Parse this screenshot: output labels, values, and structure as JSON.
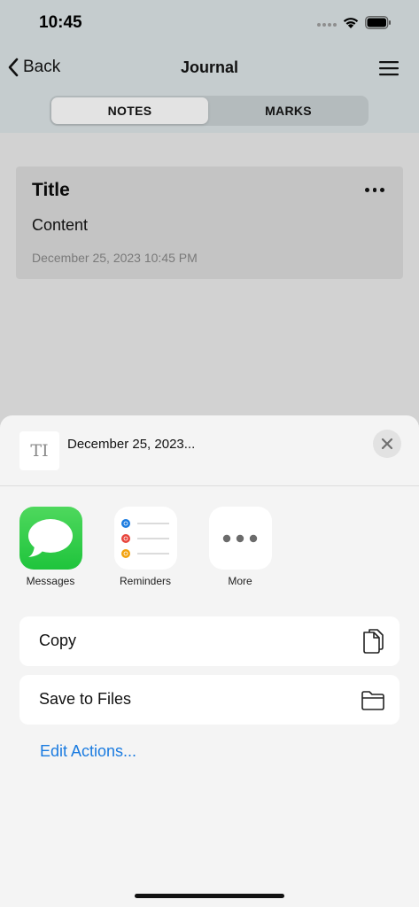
{
  "status_bar": {
    "time": "10:45"
  },
  "nav": {
    "back_label": "Back",
    "title": "Journal"
  },
  "segments": {
    "notes_label": "NOTES",
    "marks_label": "MARKS",
    "selected": "NOTES"
  },
  "note": {
    "title": "Title",
    "content": "Content",
    "date": "December 25, 2023 10:45 PM"
  },
  "share_sheet": {
    "thumb_glyph": "TI",
    "title": "December 25, 2023...",
    "apps": [
      {
        "label": "Messages"
      },
      {
        "label": "Reminders"
      },
      {
        "label": "More"
      }
    ],
    "actions": [
      {
        "label": "Copy",
        "icon": "copy-icon"
      },
      {
        "label": "Save to Files",
        "icon": "folder-icon"
      }
    ],
    "edit_actions_label": "Edit Actions..."
  },
  "colors": {
    "accent": "#1a7be0",
    "messages_green": "#1fc43c",
    "reminder_blue": "#1a7be0",
    "reminder_red": "#e8453c",
    "reminder_orange": "#f2a20d"
  }
}
